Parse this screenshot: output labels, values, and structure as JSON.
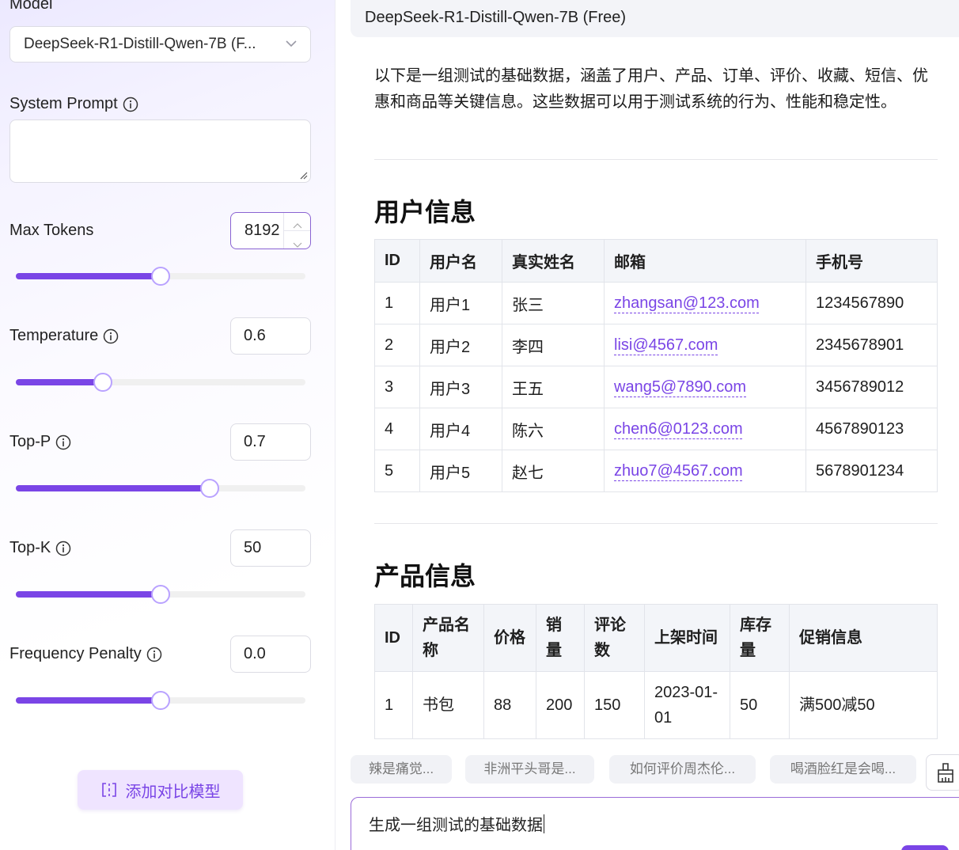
{
  "sidebar": {
    "model_label": "Model",
    "model_value": "DeepSeek-R1-Distill-Qwen-7B (F...",
    "system_prompt_label": "System Prompt",
    "system_prompt_value": "",
    "params": [
      {
        "label": "Max Tokens",
        "value": "8192",
        "level": 0.5
      },
      {
        "label": "Temperature",
        "value": "0.6",
        "level": 0.3
      },
      {
        "label": "Top-P",
        "value": "0.7",
        "level": 0.67
      },
      {
        "label": "Top-K",
        "value": "50",
        "level": 0.5
      },
      {
        "label": "Frequency Penalty",
        "value": "0.0",
        "level": 0.5
      }
    ],
    "add_model_label": "添加对比模型"
  },
  "chat": {
    "model_name": "DeepSeek-R1-Distill-Qwen-7B (Free)",
    "intro": "以下是一组测试的基础数据，涵盖了用户、产品、订单、评价、收藏、短信、优惠和商品等关键信息。这些数据可以用于测试系统的行为、性能和稳定性。",
    "section1_title": "用户信息",
    "users_table": {
      "headers": [
        "ID",
        "用户名",
        "真实姓名",
        "邮箱",
        "手机号"
      ],
      "rows": [
        [
          "1",
          "用户1",
          "张三",
          "zhangsan@123.com",
          "1234567890"
        ],
        [
          "2",
          "用户2",
          "李四",
          "lisi@4567.com",
          "2345678901"
        ],
        [
          "3",
          "用户3",
          "王五",
          "wang5@7890.com",
          "3456789012"
        ],
        [
          "4",
          "用户4",
          "陈六",
          "chen6@0123.com",
          "4567890123"
        ],
        [
          "5",
          "用户5",
          "赵七",
          "zhuo7@4567.com",
          "5678901234"
        ]
      ]
    },
    "section2_title": "产品信息",
    "products_table": {
      "headers": [
        "ID",
        "产品名称",
        "价格",
        "销量",
        "评论数",
        "上架时间",
        "库存量",
        "促销信息"
      ],
      "rows": [
        [
          "1",
          "书包",
          "88",
          "200",
          "150",
          "2023-01-01",
          "50",
          "满500减50"
        ]
      ]
    },
    "suggestions": [
      "辣是痛觉...",
      "非洲平头哥是...",
      "如何评价周杰伦...",
      "喝酒脸红是会喝..."
    ],
    "input_value": "生成一组测试的基础数据"
  },
  "colors": {
    "accent": "#7a45e6",
    "thumb_border": "#b9a2ff",
    "chip_bg": "#f1f2f6"
  }
}
